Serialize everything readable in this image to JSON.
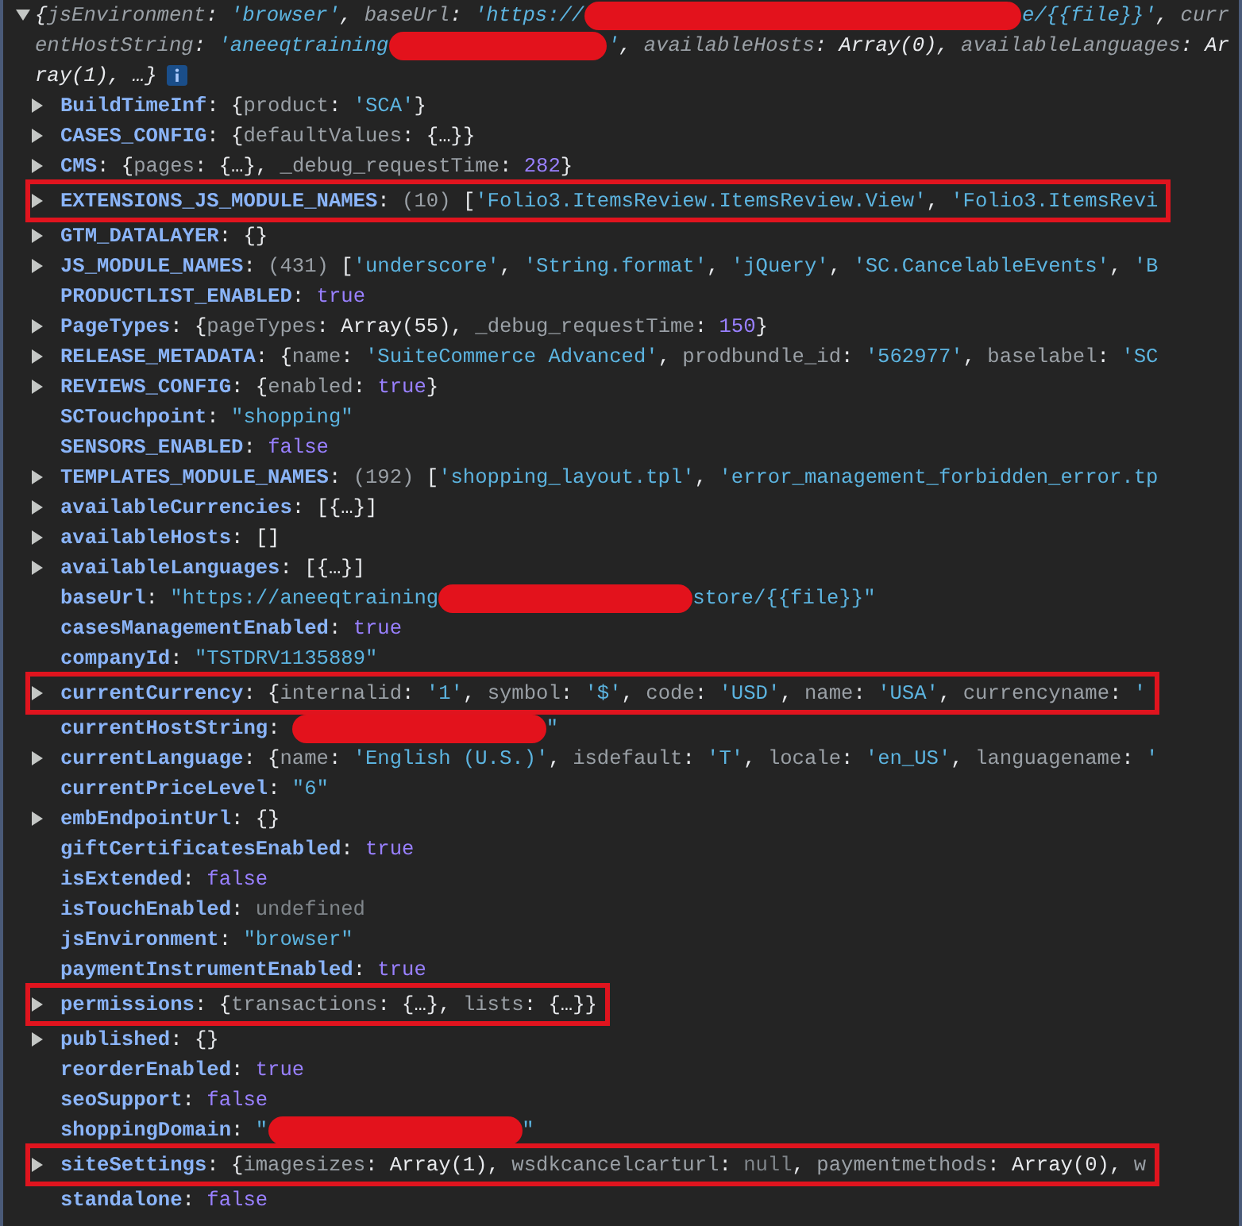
{
  "header": {
    "expanded": true,
    "lines": [
      [
        {
          "kind": "punct",
          "text": "{"
        },
        {
          "kind": "key",
          "text": "jsEnvironment"
        },
        {
          "kind": "punct",
          "text": ": "
        },
        {
          "kind": "string",
          "text": "'browser'"
        },
        {
          "kind": "punct",
          "text": ", "
        },
        {
          "kind": "key",
          "text": "baseUrl"
        },
        {
          "kind": "punct",
          "text": ": "
        },
        {
          "kind": "string",
          "text": "'https://"
        },
        {
          "kind": "redacted"
        },
        {
          "kind": "string",
          "text": "e/{{file}}'"
        },
        {
          "kind": "punct",
          "text": ", "
        },
        {
          "kind": "key",
          "text": "curr"
        }
      ],
      [
        {
          "kind": "key",
          "text": "entHostString"
        },
        {
          "kind": "punct",
          "text": ": "
        },
        {
          "kind": "string",
          "text": "'aneeqtraining"
        },
        {
          "kind": "redacted"
        },
        {
          "kind": "string",
          "text": "'"
        },
        {
          "kind": "punct",
          "text": ", "
        },
        {
          "kind": "key",
          "text": "availableHosts"
        },
        {
          "kind": "punct",
          "text": ": "
        },
        {
          "kind": "plain",
          "text": "Array(0)"
        },
        {
          "kind": "punct",
          "text": ", "
        },
        {
          "kind": "key",
          "text": "availableLanguages"
        },
        {
          "kind": "punct",
          "text": ": "
        },
        {
          "kind": "plain",
          "text": "Ar"
        }
      ],
      [
        {
          "kind": "plain",
          "text": "ray(1)"
        },
        {
          "kind": "punct",
          "text": ", …}"
        }
      ]
    ]
  },
  "rows": [
    {
      "key": "BuildTimeInf",
      "expandable": true,
      "highlighted": false,
      "parts": [
        {
          "kind": "punct",
          "text": ": {"
        },
        {
          "kind": "key",
          "text": "product"
        },
        {
          "kind": "punct",
          "text": ": "
        },
        {
          "kind": "string",
          "text": "'SCA'"
        },
        {
          "kind": "punct",
          "text": "}"
        }
      ]
    },
    {
      "key": "CASES_CONFIG",
      "expandable": true,
      "highlighted": false,
      "parts": [
        {
          "kind": "punct",
          "text": ": {"
        },
        {
          "kind": "key",
          "text": "defaultValues"
        },
        {
          "kind": "punct",
          "text": ": {…}}"
        }
      ]
    },
    {
      "key": "CMS",
      "expandable": true,
      "highlighted": false,
      "parts": [
        {
          "kind": "punct",
          "text": ": {"
        },
        {
          "kind": "key",
          "text": "pages"
        },
        {
          "kind": "punct",
          "text": ": {…}, "
        },
        {
          "kind": "key",
          "text": "_debug_requestTime"
        },
        {
          "kind": "punct",
          "text": ": "
        },
        {
          "kind": "number",
          "text": "282"
        },
        {
          "kind": "punct",
          "text": "}"
        }
      ]
    },
    {
      "key": "EXTENSIONS_JS_MODULE_NAMES",
      "expandable": true,
      "highlighted": true,
      "parts": [
        {
          "kind": "punct",
          "text": ": "
        },
        {
          "kind": "count",
          "text": "(10) "
        },
        {
          "kind": "punct",
          "text": "["
        },
        {
          "kind": "string",
          "text": "'Folio3.ItemsReview.ItemsReview.View'"
        },
        {
          "kind": "punct",
          "text": ", "
        },
        {
          "kind": "string",
          "text": "'Folio3.ItemsRevi"
        }
      ]
    },
    {
      "key": "GTM_DATALAYER",
      "expandable": true,
      "highlighted": false,
      "parts": [
        {
          "kind": "punct",
          "text": ": {}"
        }
      ]
    },
    {
      "key": "JS_MODULE_NAMES",
      "expandable": true,
      "highlighted": false,
      "parts": [
        {
          "kind": "punct",
          "text": ": "
        },
        {
          "kind": "count",
          "text": "(431) "
        },
        {
          "kind": "punct",
          "text": "["
        },
        {
          "kind": "string",
          "text": "'underscore'"
        },
        {
          "kind": "punct",
          "text": ", "
        },
        {
          "kind": "string",
          "text": "'String.format'"
        },
        {
          "kind": "punct",
          "text": ", "
        },
        {
          "kind": "string",
          "text": "'jQuery'"
        },
        {
          "kind": "punct",
          "text": ", "
        },
        {
          "kind": "string",
          "text": "'SC.CancelableEvents'"
        },
        {
          "kind": "punct",
          "text": ", "
        },
        {
          "kind": "string",
          "text": "'B"
        }
      ]
    },
    {
      "key": "PRODUCTLIST_ENABLED",
      "expandable": false,
      "highlighted": false,
      "parts": [
        {
          "kind": "punct",
          "text": ": "
        },
        {
          "kind": "literal",
          "text": "true"
        }
      ]
    },
    {
      "key": "PageTypes",
      "expandable": true,
      "highlighted": false,
      "parts": [
        {
          "kind": "punct",
          "text": ": {"
        },
        {
          "kind": "key",
          "text": "pageTypes"
        },
        {
          "kind": "punct",
          "text": ": "
        },
        {
          "kind": "plain",
          "text": "Array(55)"
        },
        {
          "kind": "punct",
          "text": ", "
        },
        {
          "kind": "key",
          "text": "_debug_requestTime"
        },
        {
          "kind": "punct",
          "text": ": "
        },
        {
          "kind": "number",
          "text": "150"
        },
        {
          "kind": "punct",
          "text": "}"
        }
      ]
    },
    {
      "key": "RELEASE_METADATA",
      "expandable": true,
      "highlighted": false,
      "parts": [
        {
          "kind": "punct",
          "text": ": {"
        },
        {
          "kind": "key",
          "text": "name"
        },
        {
          "kind": "punct",
          "text": ": "
        },
        {
          "kind": "string",
          "text": "'SuiteCommerce Advanced'"
        },
        {
          "kind": "punct",
          "text": ", "
        },
        {
          "kind": "key",
          "text": "prodbundle_id"
        },
        {
          "kind": "punct",
          "text": ": "
        },
        {
          "kind": "string",
          "text": "'562977'"
        },
        {
          "kind": "punct",
          "text": ", "
        },
        {
          "kind": "key",
          "text": "baselabel"
        },
        {
          "kind": "punct",
          "text": ": "
        },
        {
          "kind": "string",
          "text": "'SC"
        }
      ]
    },
    {
      "key": "REVIEWS_CONFIG",
      "expandable": true,
      "highlighted": false,
      "parts": [
        {
          "kind": "punct",
          "text": ": {"
        },
        {
          "kind": "key",
          "text": "enabled"
        },
        {
          "kind": "punct",
          "text": ": "
        },
        {
          "kind": "literal",
          "text": "true"
        },
        {
          "kind": "punct",
          "text": "}"
        }
      ]
    },
    {
      "key": "SCTouchpoint",
      "expandable": false,
      "highlighted": false,
      "parts": [
        {
          "kind": "punct",
          "text": ": "
        },
        {
          "kind": "string",
          "text": "\"shopping\""
        }
      ]
    },
    {
      "key": "SENSORS_ENABLED",
      "expandable": false,
      "highlighted": false,
      "parts": [
        {
          "kind": "punct",
          "text": ": "
        },
        {
          "kind": "literal",
          "text": "false"
        }
      ]
    },
    {
      "key": "TEMPLATES_MODULE_NAMES",
      "expandable": true,
      "highlighted": false,
      "parts": [
        {
          "kind": "punct",
          "text": ": "
        },
        {
          "kind": "count",
          "text": "(192) "
        },
        {
          "kind": "punct",
          "text": "["
        },
        {
          "kind": "string",
          "text": "'shopping_layout.tpl'"
        },
        {
          "kind": "punct",
          "text": ", "
        },
        {
          "kind": "string",
          "text": "'error_management_forbidden_error.tp"
        }
      ]
    },
    {
      "key": "availableCurrencies",
      "expandable": true,
      "highlighted": false,
      "parts": [
        {
          "kind": "punct",
          "text": ": [{…}]"
        }
      ]
    },
    {
      "key": "availableHosts",
      "expandable": true,
      "highlighted": false,
      "parts": [
        {
          "kind": "punct",
          "text": ": []"
        }
      ]
    },
    {
      "key": "availableLanguages",
      "expandable": true,
      "highlighted": false,
      "parts": [
        {
          "kind": "punct",
          "text": ": [{…}]"
        }
      ]
    },
    {
      "key": "baseUrl",
      "expandable": false,
      "highlighted": false,
      "parts": [
        {
          "kind": "punct",
          "text": ": "
        },
        {
          "kind": "string",
          "text": "\"https://aneeqtraining"
        },
        {
          "kind": "redacted"
        },
        {
          "kind": "string",
          "text": "store/{{file}}\""
        }
      ]
    },
    {
      "key": "casesManagementEnabled",
      "expandable": false,
      "highlighted": false,
      "parts": [
        {
          "kind": "punct",
          "text": ": "
        },
        {
          "kind": "literal",
          "text": "true"
        }
      ]
    },
    {
      "key": "companyId",
      "expandable": false,
      "highlighted": false,
      "parts": [
        {
          "kind": "punct",
          "text": ": "
        },
        {
          "kind": "string",
          "text": "\"TSTDRV1135889\""
        }
      ]
    },
    {
      "key": "currentCurrency",
      "expandable": true,
      "highlighted": true,
      "parts": [
        {
          "kind": "punct",
          "text": ": {"
        },
        {
          "kind": "key",
          "text": "internalid"
        },
        {
          "kind": "punct",
          "text": ": "
        },
        {
          "kind": "string",
          "text": "'1'"
        },
        {
          "kind": "punct",
          "text": ", "
        },
        {
          "kind": "key",
          "text": "symbol"
        },
        {
          "kind": "punct",
          "text": ": "
        },
        {
          "kind": "string",
          "text": "'$'"
        },
        {
          "kind": "punct",
          "text": ", "
        },
        {
          "kind": "key",
          "text": "code"
        },
        {
          "kind": "punct",
          "text": ": "
        },
        {
          "kind": "string",
          "text": "'USD'"
        },
        {
          "kind": "punct",
          "text": ", "
        },
        {
          "kind": "key",
          "text": "name"
        },
        {
          "kind": "punct",
          "text": ": "
        },
        {
          "kind": "string",
          "text": "'USA'"
        },
        {
          "kind": "punct",
          "text": ", "
        },
        {
          "kind": "key",
          "text": "currencyname"
        },
        {
          "kind": "punct",
          "text": ": "
        },
        {
          "kind": "string",
          "text": "'"
        }
      ]
    },
    {
      "key": "currentHostString",
      "expandable": false,
      "highlighted": false,
      "parts": [
        {
          "kind": "punct",
          "text": ": "
        },
        {
          "kind": "redacted"
        },
        {
          "kind": "string",
          "text": "\""
        }
      ]
    },
    {
      "key": "currentLanguage",
      "expandable": true,
      "highlighted": false,
      "parts": [
        {
          "kind": "punct",
          "text": ": {"
        },
        {
          "kind": "key",
          "text": "name"
        },
        {
          "kind": "punct",
          "text": ": "
        },
        {
          "kind": "string",
          "text": "'English (U.S.)'"
        },
        {
          "kind": "punct",
          "text": ", "
        },
        {
          "kind": "key",
          "text": "isdefault"
        },
        {
          "kind": "punct",
          "text": ": "
        },
        {
          "kind": "string",
          "text": "'T'"
        },
        {
          "kind": "punct",
          "text": ", "
        },
        {
          "kind": "key",
          "text": "locale"
        },
        {
          "kind": "punct",
          "text": ": "
        },
        {
          "kind": "string",
          "text": "'en_US'"
        },
        {
          "kind": "punct",
          "text": ", "
        },
        {
          "kind": "key",
          "text": "languagename"
        },
        {
          "kind": "punct",
          "text": ": "
        },
        {
          "kind": "string",
          "text": "'"
        }
      ]
    },
    {
      "key": "currentPriceLevel",
      "expandable": false,
      "highlighted": false,
      "parts": [
        {
          "kind": "punct",
          "text": ": "
        },
        {
          "kind": "string",
          "text": "\"6\""
        }
      ]
    },
    {
      "key": "embEndpointUrl",
      "expandable": true,
      "highlighted": false,
      "parts": [
        {
          "kind": "punct",
          "text": ": {}"
        }
      ]
    },
    {
      "key": "giftCertificatesEnabled",
      "expandable": false,
      "highlighted": false,
      "parts": [
        {
          "kind": "punct",
          "text": ": "
        },
        {
          "kind": "literal",
          "text": "true"
        }
      ]
    },
    {
      "key": "isExtended",
      "expandable": false,
      "highlighted": false,
      "parts": [
        {
          "kind": "punct",
          "text": ": "
        },
        {
          "kind": "literal",
          "text": "false"
        }
      ]
    },
    {
      "key": "isTouchEnabled",
      "expandable": false,
      "highlighted": false,
      "parts": [
        {
          "kind": "punct",
          "text": ": "
        },
        {
          "kind": "muted",
          "text": "undefined"
        }
      ]
    },
    {
      "key": "jsEnvironment",
      "expandable": false,
      "highlighted": false,
      "parts": [
        {
          "kind": "punct",
          "text": ": "
        },
        {
          "kind": "string",
          "text": "\"browser\""
        }
      ]
    },
    {
      "key": "paymentInstrumentEnabled",
      "expandable": false,
      "highlighted": false,
      "parts": [
        {
          "kind": "punct",
          "text": ": "
        },
        {
          "kind": "literal",
          "text": "true"
        }
      ]
    },
    {
      "key": "permissions",
      "expandable": true,
      "highlighted": true,
      "parts": [
        {
          "kind": "punct",
          "text": ": {"
        },
        {
          "kind": "key",
          "text": "transactions"
        },
        {
          "kind": "punct",
          "text": ": {…}, "
        },
        {
          "kind": "key",
          "text": "lists"
        },
        {
          "kind": "punct",
          "text": ": {…}}"
        }
      ]
    },
    {
      "key": "published",
      "expandable": true,
      "highlighted": false,
      "parts": [
        {
          "kind": "punct",
          "text": ": {}"
        }
      ]
    },
    {
      "key": "reorderEnabled",
      "expandable": false,
      "highlighted": false,
      "parts": [
        {
          "kind": "punct",
          "text": ": "
        },
        {
          "kind": "literal",
          "text": "true"
        }
      ]
    },
    {
      "key": "seoSupport",
      "expandable": false,
      "highlighted": false,
      "parts": [
        {
          "kind": "punct",
          "text": ": "
        },
        {
          "kind": "literal",
          "text": "false"
        }
      ]
    },
    {
      "key": "shoppingDomain",
      "expandable": false,
      "highlighted": false,
      "parts": [
        {
          "kind": "punct",
          "text": ": "
        },
        {
          "kind": "string",
          "text": "\""
        },
        {
          "kind": "redacted"
        },
        {
          "kind": "string",
          "text": "\""
        }
      ]
    },
    {
      "key": "siteSettings",
      "expandable": true,
      "highlighted": true,
      "parts": [
        {
          "kind": "punct",
          "text": ": {"
        },
        {
          "kind": "key",
          "text": "imagesizes"
        },
        {
          "kind": "punct",
          "text": ": "
        },
        {
          "kind": "plain",
          "text": "Array(1)"
        },
        {
          "kind": "punct",
          "text": ", "
        },
        {
          "kind": "key",
          "text": "wsdkcancelcarturl"
        },
        {
          "kind": "punct",
          "text": ": "
        },
        {
          "kind": "muted",
          "text": "null"
        },
        {
          "kind": "punct",
          "text": ", "
        },
        {
          "kind": "key",
          "text": "paymentmethods"
        },
        {
          "kind": "punct",
          "text": ": "
        },
        {
          "kind": "plain",
          "text": "Array(0)"
        },
        {
          "kind": "punct",
          "text": ", "
        },
        {
          "kind": "key",
          "text": "w"
        }
      ]
    },
    {
      "key": "standalone",
      "expandable": false,
      "highlighted": false,
      "parts": [
        {
          "kind": "punct",
          "text": ": "
        },
        {
          "kind": "literal",
          "text": "false"
        }
      ]
    }
  ]
}
